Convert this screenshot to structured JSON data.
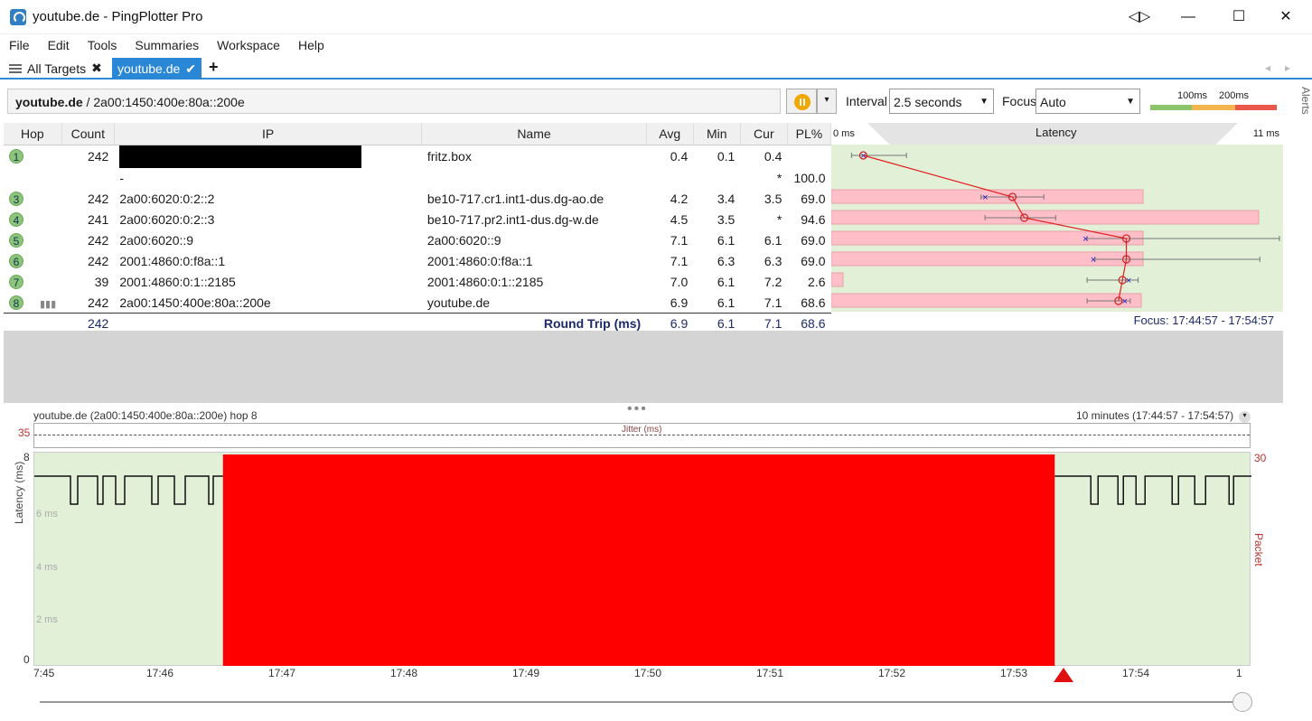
{
  "window": {
    "title": "youtube.de - PingPlotter Pro",
    "btn_sizing": "◁▷",
    "btn_min": "—",
    "btn_max": "☐",
    "btn_close": "✕"
  },
  "menu": [
    "File",
    "Edit",
    "Tools",
    "Summaries",
    "Workspace",
    "Help"
  ],
  "tabs": {
    "all_label": "All Targets",
    "all_close": "✖",
    "active_label": "youtube.de",
    "active_check": "✔",
    "add": "+",
    "prev": "◂",
    "next": "▸"
  },
  "toolbar": {
    "target": "youtube.de",
    "path": " / 2a00:1450:400e:80a::200e",
    "interval_label": "Interval",
    "interval_value": "2.5 seconds",
    "focus_label": "Focus",
    "focus_value": "Auto",
    "legend_100": "100ms",
    "legend_200": "200ms",
    "alerts": "Alerts",
    "dropdown_arrow": "▾"
  },
  "colors": {
    "good": "#8bc46a",
    "warn": "#f3b64f",
    "bad": "#e9584a",
    "loss_bar": "#ffbfc8",
    "graph_loss": "#ff0000"
  },
  "table": {
    "headers": [
      "Hop",
      "Count",
      "IP",
      "Name",
      "Avg",
      "Min",
      "Cur",
      "PL%"
    ],
    "rows": [
      {
        "hop": "1",
        "count": "242",
        "ip": "",
        "redacted": true,
        "name": "fritz.box",
        "avg": "0.4",
        "min": "0.1",
        "cur": "0.4",
        "pl": "",
        "loss": 0
      },
      {
        "hop": "",
        "count": "",
        "ip": "-",
        "name": "",
        "avg": "",
        "min": "",
        "cur": "*",
        "pl": "100.0",
        "loss": 0
      },
      {
        "hop": "3",
        "count": "242",
        "ip": "2a00:6020:0:2::2",
        "name": "be10-717.cr1.int1-dus.dg-ao.de",
        "avg": "4.2",
        "min": "3.4",
        "cur": "3.5",
        "pl": "69.0",
        "loss": 69.0
      },
      {
        "hop": "4",
        "count": "241",
        "ip": "2a00:6020:0:2::3",
        "name": "be10-717.pr2.int1-dus.dg-w.de",
        "avg": "4.5",
        "min": "3.5",
        "cur": "*",
        "pl": "94.6",
        "loss": 94.6
      },
      {
        "hop": "5",
        "count": "242",
        "ip": "2a00:6020::9",
        "name": "2a00:6020::9",
        "avg": "7.1",
        "min": "6.1",
        "cur": "6.1",
        "pl": "69.0",
        "loss": 69.0
      },
      {
        "hop": "6",
        "count": "242",
        "ip": "2001:4860:0:f8a::1",
        "name": "2001:4860:0:f8a::1",
        "avg": "7.1",
        "min": "6.3",
        "cur": "6.3",
        "pl": "69.0",
        "loss": 69.0
      },
      {
        "hop": "7",
        "count": "39",
        "ip": "2001:4860:0:1::2185",
        "name": "2001:4860:0:1::2185",
        "avg": "7.0",
        "min": "6.1",
        "cur": "7.2",
        "pl": "2.6",
        "loss": 2.6
      },
      {
        "hop": "8",
        "count": "242",
        "ip": "2a00:1450:400e:80a::200e",
        "name": "youtube.de",
        "avg": "6.9",
        "min": "6.1",
        "cur": "7.1",
        "pl": "68.6",
        "loss": 68.6
      }
    ],
    "summary": {
      "count": "242",
      "label": "Round Trip (ms)",
      "avg": "6.9",
      "min": "6.1",
      "cur": "7.1",
      "pl": "68.6"
    }
  },
  "latency": {
    "header": "Latency",
    "min_label": "0 ms",
    "max_label": "11 ms",
    "focus": "Focus: 17:44:57 - 17:54:57",
    "max_ms": 11,
    "points": [
      {
        "avg": 0.4,
        "min": 0.1,
        "max": 1.5,
        "cur": 0.4
      },
      null,
      {
        "avg": 4.2,
        "min": 3.4,
        "max": 5.0,
        "cur": 3.5
      },
      {
        "avg": 4.5,
        "min": 3.5,
        "max": 5.3,
        "cur": null
      },
      {
        "avg": 7.1,
        "min": 6.1,
        "max": 11,
        "cur": 6.1
      },
      {
        "avg": 7.1,
        "min": 6.3,
        "max": 10.5,
        "cur": 6.3
      },
      {
        "avg": 7.0,
        "min": 6.1,
        "max": 7.4,
        "cur": 7.2
      },
      {
        "avg": 6.9,
        "min": 6.1,
        "max": 7.2,
        "cur": 7.1
      }
    ]
  },
  "graph": {
    "title": "youtube.de (2a00:1450:400e:80a::200e) hop 8",
    "range": "10 minutes (17:44:57 - 17:54:57)",
    "jitter": "Jitter (ms)",
    "jitter_max": "35",
    "y_max": "8",
    "y_6": "6 ms",
    "y_4": "4 ms",
    "y_2": "2 ms",
    "y_0": "0",
    "y_loss": "30",
    "ylabel": "Latency (ms)",
    "ylabel2": "Packet Loss %",
    "xticks": [
      "7:45",
      "17:46",
      "17:47",
      "17:48",
      "17:49",
      "17:50",
      "17:51",
      "17:52",
      "17:53",
      "17:54",
      "1"
    ],
    "loss_start": "17:46:30",
    "loss_end": "17:53:20"
  }
}
